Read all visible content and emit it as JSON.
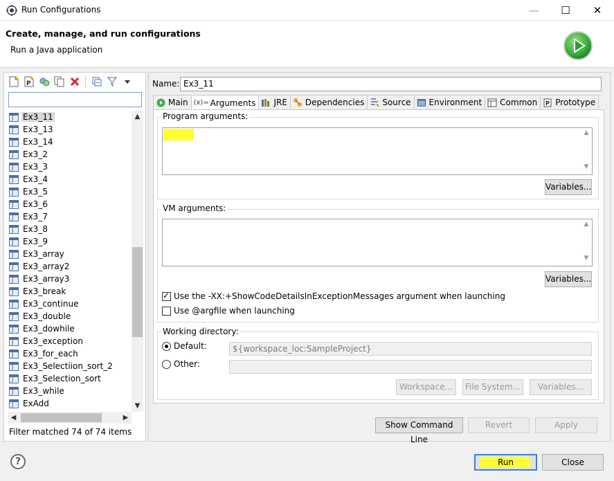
{
  "window": {
    "title": "Run Configurations",
    "minimize": "—",
    "maximize": "☐",
    "close": "✕"
  },
  "header": {
    "title": "Create, manage, and run configurations",
    "subtitle": "Run a Java application"
  },
  "left_panel": {
    "filter_value": "",
    "items": [
      "Ex3_11",
      "Ex3_13",
      "Ex3_14",
      "Ex3_2",
      "Ex3_3",
      "Ex3_4",
      "Ex3_5",
      "Ex3_6",
      "Ex3_7",
      "Ex3_8",
      "Ex3_9",
      "Ex3_array",
      "Ex3_array2",
      "Ex3_array3",
      "Ex3_break",
      "Ex3_continue",
      "Ex3_double",
      "Ex3_dowhile",
      "Ex3_exception",
      "Ex3_for_each",
      "Ex3_Selectiion_sort_2",
      "Ex3_Selection_sort",
      "Ex3_while",
      "ExAdd"
    ],
    "selected_index": 0,
    "filter_status": "Filter matched 74 of 74 items"
  },
  "right_panel": {
    "name_label": "Name:",
    "name_value": "Ex3_11",
    "tabs": [
      {
        "label": "Main",
        "icon": "main-tab-icon"
      },
      {
        "label": "Arguments",
        "icon": "arguments-tab-icon"
      },
      {
        "label": "JRE",
        "icon": "jre-tab-icon"
      },
      {
        "label": "Dependencies",
        "icon": "dependencies-tab-icon"
      },
      {
        "label": "Source",
        "icon": "source-tab-icon"
      },
      {
        "label": "Environment",
        "icon": "environment-tab-icon"
      },
      {
        "label": "Common",
        "icon": "common-tab-icon"
      },
      {
        "label": "Prototype",
        "icon": "prototype-tab-icon"
      }
    ],
    "active_tab": "Arguments",
    "program_args_label": "Program arguments:",
    "program_args_value": "",
    "vm_args_label": "VM arguments:",
    "vm_args_value": "",
    "variables_label": "Variables...",
    "show_code_details": {
      "label": "Use the -XX:+ShowCodeDetailsInExceptionMessages argument when launching",
      "checked": true
    },
    "argfile": {
      "label": "Use @argfile when launching",
      "checked": false
    },
    "working_dir": {
      "label": "Working directory:",
      "default_label": "Default:",
      "default_value": "${workspace_loc:SampleProject}",
      "other_label": "Other:",
      "other_value": "",
      "workspace_btn": "Workspace...",
      "filesystem_btn": "File System...",
      "variables_btn": "Variables..."
    },
    "show_command_line": "Show Command Line",
    "revert": "Revert",
    "apply": "Apply"
  },
  "footer": {
    "help": "?",
    "run": "Run",
    "close": "Close"
  },
  "colors": {
    "highlight": "#ffff33",
    "run_logo": "#3cb043",
    "focus_border": "#3c7fd8"
  }
}
